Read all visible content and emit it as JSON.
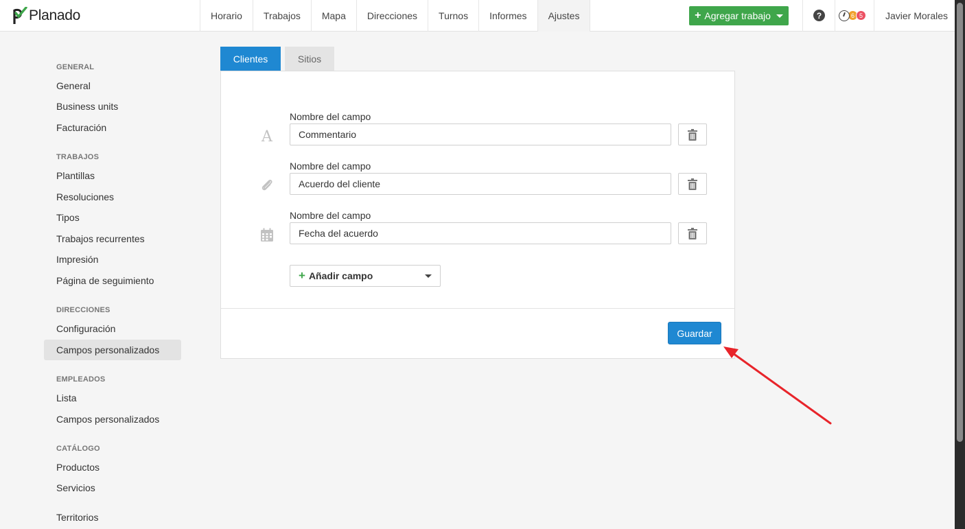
{
  "app": {
    "name": "Planado"
  },
  "nav": {
    "items": [
      {
        "label": "Horario"
      },
      {
        "label": "Trabajos"
      },
      {
        "label": "Mapa"
      },
      {
        "label": "Direcciones"
      },
      {
        "label": "Turnos"
      },
      {
        "label": "Informes"
      },
      {
        "label": "Ajustes",
        "active": true
      }
    ],
    "add_job_label": "Agregar trabajo",
    "help_glyph": "?",
    "badge_orange": "6",
    "badge_red": "5",
    "user_name": "Javier Morales"
  },
  "sidebar": {
    "general_heading": "GENERAL",
    "general": [
      "General",
      "Business units",
      "Facturación"
    ],
    "trabajos_heading": "TRABAJOS",
    "trabajos": [
      "Plantillas",
      "Resoluciones",
      "Tipos",
      "Trabajos recurrentes",
      "Impresión",
      "Página de seguimiento"
    ],
    "direcciones_heading": "DIRECCIONES",
    "direcciones": [
      "Configuración",
      "Campos personalizados"
    ],
    "empleados_heading": "EMPLEADOS",
    "empleados": [
      "Lista",
      "Campos personalizados"
    ],
    "catalogo_heading": "CATÁLOGO",
    "catalogo": [
      "Productos",
      "Servicios"
    ],
    "territorios": "Territorios"
  },
  "tabs": {
    "clientes": "Clientes",
    "sitios": "Sitios"
  },
  "fields": [
    {
      "label": "Nombre del campo",
      "value": "Commentario",
      "icon": "text-icon"
    },
    {
      "label": "Nombre del campo",
      "value": "Acuerdo del cliente",
      "icon": "paperclip-icon"
    },
    {
      "label": "Nombre del campo",
      "value": "Fecha del acuerdo",
      "icon": "calendar-icon"
    }
  ],
  "add_field_label": "Añadir campo",
  "save_label": "Guardar",
  "colors": {
    "primary": "#1f88d2",
    "success": "#3fa64b",
    "annotation": "#e8242a"
  }
}
